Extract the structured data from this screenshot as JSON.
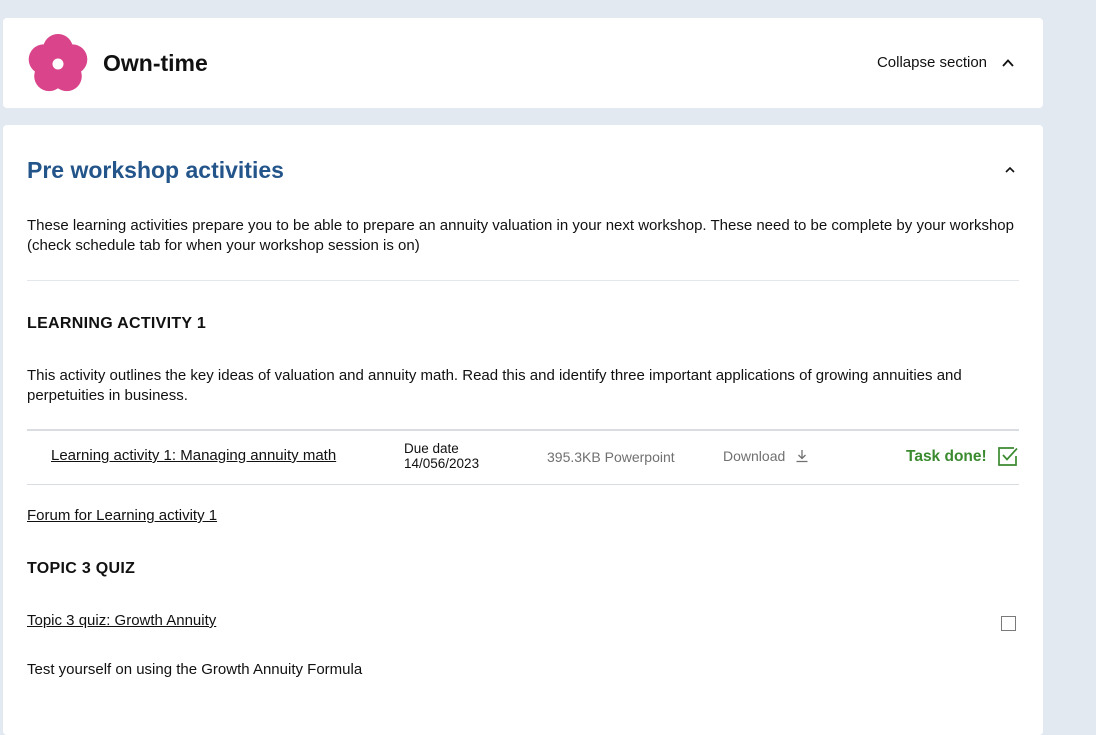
{
  "header": {
    "title": "Own-time",
    "collapse_label": "Collapse section",
    "logo_color": "#d9448a"
  },
  "section": {
    "title": "Pre workshop activities",
    "intro": "These learning activities prepare you to be able to prepare an annuity valuation in your next workshop. These need to be complete by your workshop (check schedule tab for when your workshop session is on)",
    "activity1": {
      "heading": "LEARNING ACTIVITY 1",
      "description": "This activity outlines the key ideas of valuation and annuity math. Read this and identify three important applications of growing annuities and perpetuities in business.",
      "file": {
        "name": "Learning activity 1: Managing annuity math",
        "due_label": "Due date",
        "due_value": "14/056/2023",
        "size": "395.3KB Powerpoint",
        "download_label": "Download",
        "status": "Task done!",
        "completed": true
      },
      "forum_link": "Forum for Learning activity 1"
    },
    "quiz": {
      "heading": "TOPIC 3 QUIZ",
      "link": "Topic 3 quiz: Growth Annuity",
      "description": "Test yourself on using the Growth Annuity Formula",
      "completed": false
    }
  },
  "colors": {
    "accent_blue": "#23558a",
    "success_green": "#3a8a2e",
    "background": "#e3e9f1"
  }
}
